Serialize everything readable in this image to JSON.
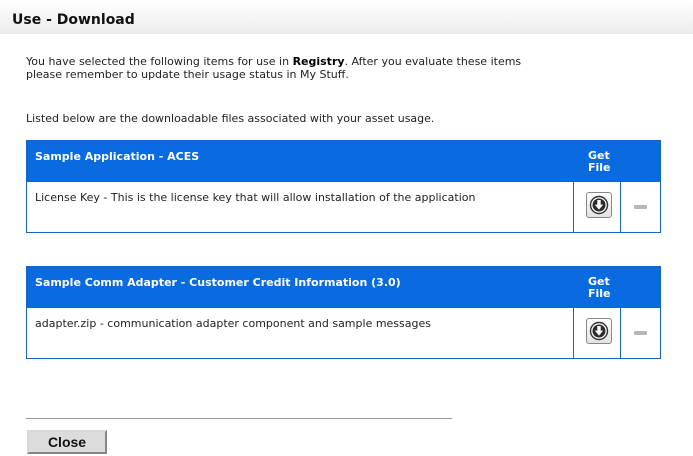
{
  "window": {
    "title": "Use - Download"
  },
  "intro": {
    "line1_prefix": "You have selected the following items for use in ",
    "line1_bold": "Registry",
    "line1_suffix": ". After you evaluate these items",
    "line2": "please remember to update their usage status in My Stuff."
  },
  "listed_text": "Listed below are the downloadable files associated with your asset usage.",
  "assets": [
    {
      "name": "Sample Application - ACES",
      "get_file_line1": "Get",
      "get_file_line2": "File",
      "files": [
        {
          "description": "License Key - This is the license key that will allow installation of the application",
          "download_icon": "download-arrow-icon",
          "remove_icon": "minus-icon"
        }
      ]
    },
    {
      "name": "Sample Comm Adapter - Customer Credit Information (3.0)",
      "get_file_line1": "Get",
      "get_file_line2": "File",
      "files": [
        {
          "description": "adapter.zip - communication adapter component and sample messages",
          "download_icon": "download-arrow-icon",
          "remove_icon": "minus-icon"
        }
      ]
    }
  ],
  "close_label": "Close",
  "colors": {
    "header_blue": "#0a6be0",
    "border_blue": "#1565c8",
    "title_text": "#111111",
    "button_gray": "#dcdcdc"
  }
}
